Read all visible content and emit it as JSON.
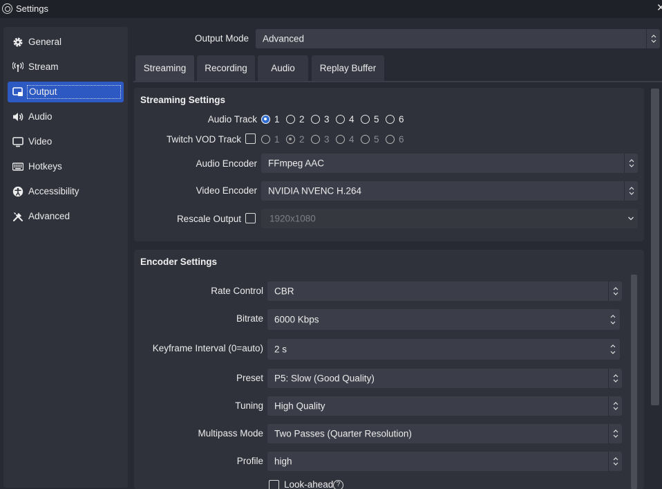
{
  "window": {
    "title": "Settings",
    "close_glyph": "✕"
  },
  "sidebar": {
    "items": [
      {
        "label": "General",
        "icon": "gear-icon"
      },
      {
        "label": "Stream",
        "icon": "antenna-icon"
      },
      {
        "label": "Output",
        "icon": "output-icon"
      },
      {
        "label": "Audio",
        "icon": "speaker-icon"
      },
      {
        "label": "Video",
        "icon": "monitor-icon"
      },
      {
        "label": "Hotkeys",
        "icon": "keyboard-icon"
      },
      {
        "label": "Accessibility",
        "icon": "accessibility-icon"
      },
      {
        "label": "Advanced",
        "icon": "tools-icon"
      }
    ],
    "selected": "Output"
  },
  "output_mode": {
    "label": "Output Mode",
    "value": "Advanced"
  },
  "tabs": [
    {
      "label": "Streaming",
      "active": true
    },
    {
      "label": "Recording",
      "active": false
    },
    {
      "label": "Audio",
      "active": false
    },
    {
      "label": "Replay Buffer",
      "active": false
    }
  ],
  "streaming_settings": {
    "title": "Streaming Settings",
    "audio_track": {
      "label": "Audio Track",
      "options": [
        "1",
        "2",
        "3",
        "4",
        "5",
        "6"
      ],
      "selected": "1"
    },
    "twitch_vod_track": {
      "label": "Twitch VOD Track",
      "checked": false,
      "options": [
        "1",
        "2",
        "3",
        "4",
        "5",
        "6"
      ],
      "selected": "2"
    },
    "audio_encoder": {
      "label": "Audio Encoder",
      "value": "FFmpeg AAC"
    },
    "video_encoder": {
      "label": "Video Encoder",
      "value": "NVIDIA NVENC H.264"
    },
    "rescale_output": {
      "label": "Rescale Output",
      "checked": false,
      "value": "1920x1080"
    }
  },
  "encoder_settings": {
    "title": "Encoder Settings",
    "rate_control": {
      "label": "Rate Control",
      "value": "CBR"
    },
    "bitrate": {
      "label": "Bitrate",
      "value": "6000 Kbps"
    },
    "keyframe_interval": {
      "label": "Keyframe Interval (0=auto)",
      "value": "2 s"
    },
    "preset": {
      "label": "Preset",
      "value": "P5: Slow (Good Quality)"
    },
    "tuning": {
      "label": "Tuning",
      "value": "High Quality"
    },
    "multipass_mode": {
      "label": "Multipass Mode",
      "value": "Two Passes (Quarter Resolution)"
    },
    "profile": {
      "label": "Profile",
      "value": "high"
    },
    "look_ahead": {
      "label": "Look-ahead",
      "checked": false,
      "help_glyph": "?"
    }
  },
  "colors": {
    "accent": "#2d59c2",
    "background": "#272a33",
    "panel": "#2f323b",
    "input": "#3b3e48"
  }
}
